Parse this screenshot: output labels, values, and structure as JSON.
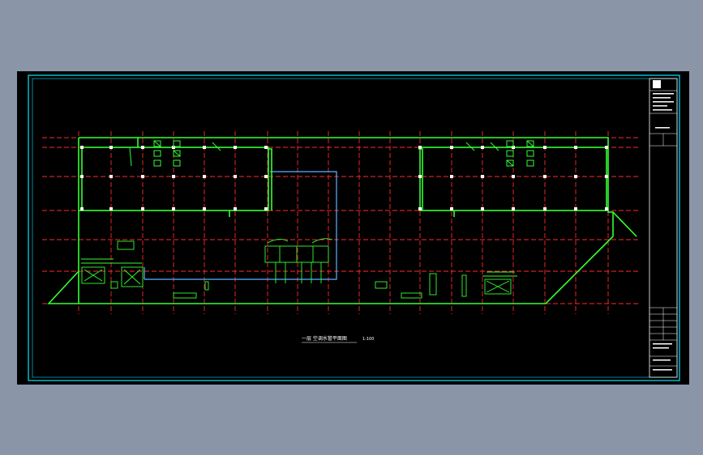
{
  "drawing": {
    "sheet_title": "一层 空调水管平面图",
    "scale_label": "1:100"
  },
  "title_block": {
    "label": "图签"
  },
  "colors": {
    "background_outer": "#8a95a8",
    "sheet": "#000000",
    "border": "#00e5ff",
    "wall": "#33ff33",
    "axis": "#ff2a2a",
    "duct": "#5ab4ff",
    "text": "#ffffff"
  }
}
